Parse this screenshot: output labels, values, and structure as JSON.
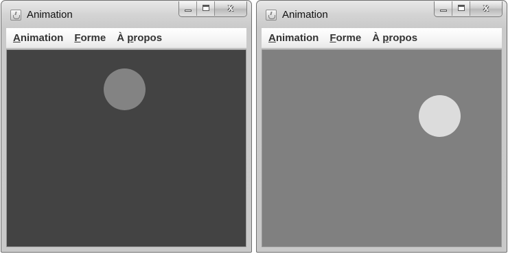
{
  "windows": [
    {
      "title": "Animation",
      "menu": [
        {
          "mnemonic": "A",
          "rest": "nimation"
        },
        {
          "mnemonic": "F",
          "rest": "orme"
        },
        {
          "prefix": "À ",
          "mnemonic": "p",
          "rest": "ropos"
        }
      ],
      "canvas_color": "#434343",
      "shape": {
        "type": "circle",
        "color": "#838383"
      }
    },
    {
      "title": "Animation",
      "menu": [
        {
          "mnemonic": "A",
          "rest": "nimation"
        },
        {
          "mnemonic": "F",
          "rest": "orme"
        },
        {
          "prefix": "À ",
          "mnemonic": "p",
          "rest": "ropos"
        }
      ],
      "canvas_color": "#808080",
      "shape": {
        "type": "circle",
        "color": "#dcdcdc"
      }
    }
  ],
  "caption_buttons": {
    "close_label": "x"
  },
  "icons": [
    "java-app-icon",
    "minimize-icon",
    "maximize-icon",
    "close-icon"
  ]
}
